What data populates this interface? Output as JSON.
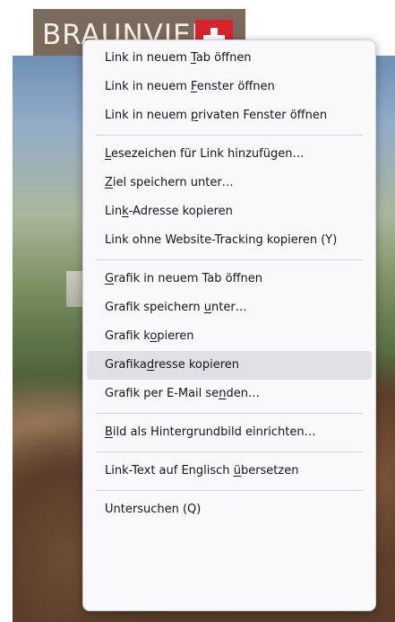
{
  "logo": {
    "text": "BRAUNVIEH",
    "flag_icon": "swiss-cross-icon"
  },
  "context_menu": {
    "groups": [
      [
        {
          "pre": "Link in neuem ",
          "key": "T",
          "post": "ab öffnen"
        },
        {
          "pre": "Link in neuem ",
          "key": "F",
          "post": "enster öffnen"
        },
        {
          "pre": "Link in neuem ",
          "key": "p",
          "post": "rivaten Fenster öffnen"
        }
      ],
      [
        {
          "pre": "",
          "key": "L",
          "post": "esezeichen für Link hinzufügen…"
        },
        {
          "pre": "",
          "key": "Z",
          "post": "iel speichern unter…"
        },
        {
          "pre": "Lin",
          "key": "k",
          "post": "-Adresse kopieren"
        },
        {
          "pre": "Link ohne Website-Tracking kopieren (Y)",
          "key": "",
          "post": ""
        }
      ],
      [
        {
          "pre": "",
          "key": "G",
          "post": "rafik in neuem Tab öffnen"
        },
        {
          "pre": "Grafik speichern ",
          "key": "u",
          "post": "nter…"
        },
        {
          "pre": "Grafik k",
          "key": "o",
          "post": "pieren"
        },
        {
          "pre": "Grafika",
          "key": "d",
          "post": "resse kopieren",
          "highlighted": true
        },
        {
          "pre": "Grafik per E-Mail se",
          "key": "n",
          "post": "den…"
        }
      ],
      [
        {
          "pre": "",
          "key": "B",
          "post": "ild als Hintergrundbild einrichten…"
        }
      ],
      [
        {
          "pre": "Link-Text auf Englisch ",
          "key": "ü",
          "post": "bersetzen"
        }
      ],
      [
        {
          "pre": "Untersuchen (Q)",
          "key": "",
          "post": ""
        }
      ]
    ]
  }
}
